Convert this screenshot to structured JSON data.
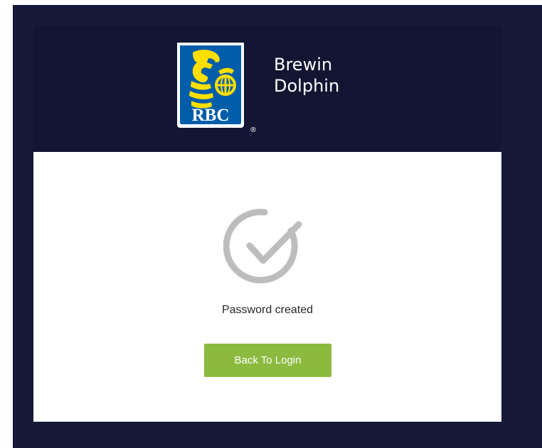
{
  "brand": {
    "logo_text": "RBC",
    "name_line1": "Brewin",
    "name_line2": "Dolphin"
  },
  "confirmation": {
    "message": "Password created"
  },
  "actions": {
    "back_to_login_label": "Back To Login"
  },
  "colors": {
    "page_bg": "#161a38",
    "header_bg": "#121632",
    "logo_blue": "#005daa",
    "logo_gold": "#fedf01",
    "check_gray": "#bdbdbd",
    "button_green": "#8bba3f"
  },
  "icons": {
    "status": "check-circle-icon"
  }
}
